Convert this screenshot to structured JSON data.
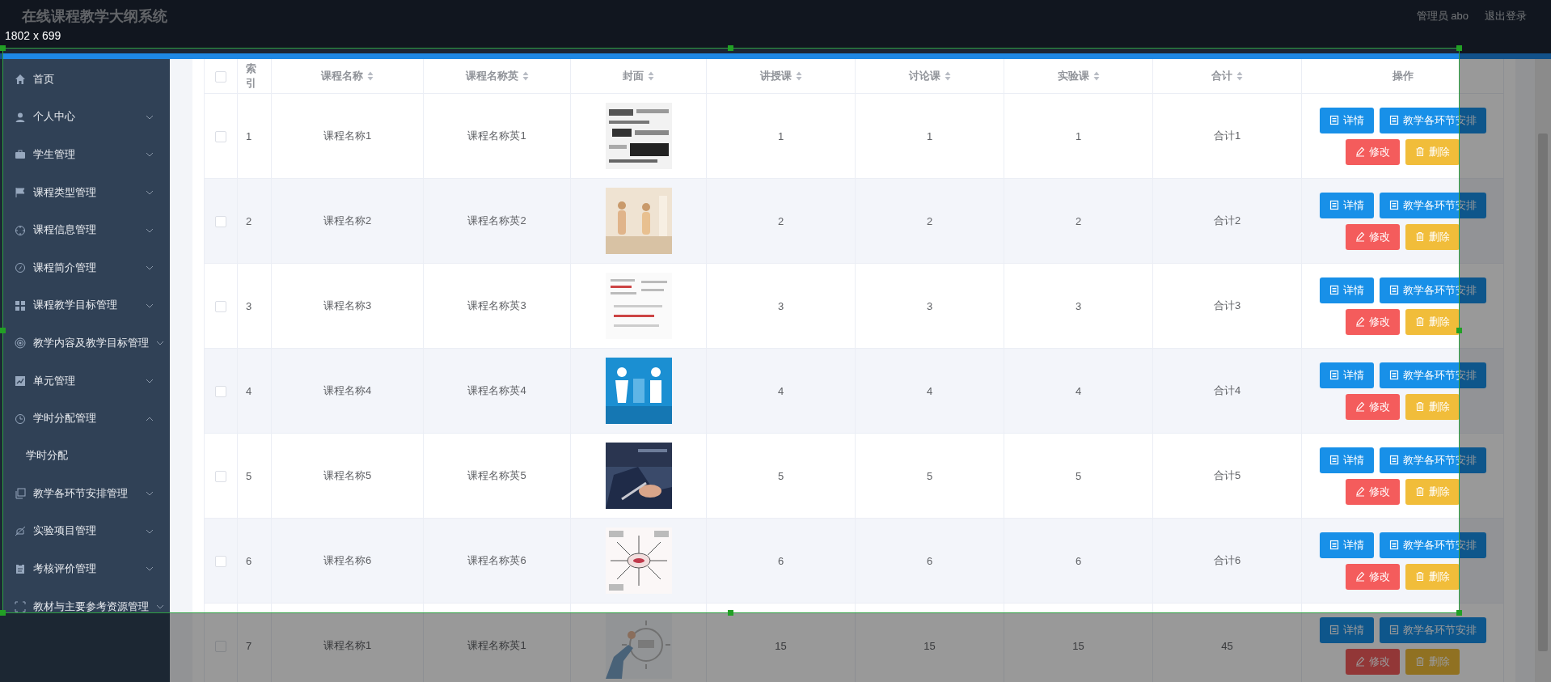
{
  "header": {
    "title": "在线课程教学大纲系统",
    "user": "管理员 abo",
    "logout": "退出登录"
  },
  "sidebar": {
    "items": [
      {
        "label": "首页"
      },
      {
        "label": "个人中心",
        "expanded": false
      },
      {
        "label": "学生管理",
        "expanded": false
      },
      {
        "label": "课程类型管理",
        "expanded": false
      },
      {
        "label": "课程信息管理",
        "expanded": false
      },
      {
        "label": "课程简介管理",
        "expanded": false
      },
      {
        "label": "课程教学目标管理",
        "expanded": false
      },
      {
        "label": "教学内容及教学目标管理",
        "expanded": false
      },
      {
        "label": "单元管理",
        "expanded": false
      },
      {
        "label": "学时分配管理",
        "expanded": true,
        "children": [
          {
            "label": "学时分配"
          }
        ]
      },
      {
        "label": "教学各环节安排管理",
        "expanded": false
      },
      {
        "label": "实验项目管理",
        "expanded": false
      },
      {
        "label": "考核评价管理",
        "expanded": false
      },
      {
        "label": "教材与主要参考资源管理",
        "expanded": false
      }
    ]
  },
  "table": {
    "select_all": {
      "checked": false
    },
    "columns": [
      {
        "label": "索引",
        "sortable": false
      },
      {
        "label": "课程名称",
        "sortable": true
      },
      {
        "label": "课程名称英",
        "sortable": true
      },
      {
        "label": "封面",
        "sortable": true
      },
      {
        "label": "讲授课",
        "sortable": true
      },
      {
        "label": "讨论课",
        "sortable": true
      },
      {
        "label": "实验课",
        "sortable": true
      },
      {
        "label": "合计",
        "sortable": true
      },
      {
        "label": "操作",
        "sortable": false
      }
    ],
    "rows": [
      {
        "checked": false,
        "cells": [
          "1",
          "课程名称1",
          "课程名称英1",
          {
            "kind": "picture"
          },
          "1",
          "1",
          "1",
          "合计1",
          {
            "actions": [
              {
                "label": "详情",
                "kind": "info"
              },
              {
                "label": "教学各环节安排",
                "kind": "info"
              },
              {
                "label": "修改",
                "kind": "edit"
              },
              {
                "label": "删除",
                "kind": "delete"
              }
            ]
          }
        ]
      },
      {
        "checked": false,
        "cells": [
          "2",
          "课程名称2",
          "课程名称英2",
          {
            "kind": "picture"
          },
          "2",
          "2",
          "2",
          "合计2",
          {
            "actions": [
              {
                "label": "详情",
                "kind": "info"
              },
              {
                "label": "教学各环节安排",
                "kind": "info"
              },
              {
                "label": "修改",
                "kind": "edit"
              },
              {
                "label": "删除",
                "kind": "delete"
              }
            ]
          }
        ]
      },
      {
        "checked": false,
        "cells": [
          "3",
          "课程名称3",
          "课程名称英3",
          {
            "kind": "picture"
          },
          "3",
          "3",
          "3",
          "合计3",
          {
            "actions": [
              {
                "label": "详情",
                "kind": "info"
              },
              {
                "label": "教学各环节安排",
                "kind": "info"
              },
              {
                "label": "修改",
                "kind": "edit"
              },
              {
                "label": "删除",
                "kind": "delete"
              }
            ]
          }
        ]
      },
      {
        "checked": false,
        "cells": [
          "4",
          "课程名称4",
          "课程名称英4",
          {
            "kind": "picture"
          },
          "4",
          "4",
          "4",
          "合计4",
          {
            "actions": [
              {
                "label": "详情",
                "kind": "info"
              },
              {
                "label": "教学各环节安排",
                "kind": "info"
              },
              {
                "label": "修改",
                "kind": "edit"
              },
              {
                "label": "删除",
                "kind": "delete"
              }
            ]
          }
        ]
      },
      {
        "checked": false,
        "cells": [
          "5",
          "课程名称5",
          "课程名称英5",
          {
            "kind": "picture"
          },
          "5",
          "5",
          "5",
          "合计5",
          {
            "actions": [
              {
                "label": "详情",
                "kind": "info"
              },
              {
                "label": "教学各环节安排",
                "kind": "info"
              },
              {
                "label": "修改",
                "kind": "edit"
              },
              {
                "label": "删除",
                "kind": "delete"
              }
            ]
          }
        ]
      },
      {
        "checked": false,
        "cells": [
          "6",
          "课程名称6",
          "课程名称英6",
          {
            "kind": "picture"
          },
          "6",
          "6",
          "6",
          "合计6",
          {
            "actions": [
              {
                "label": "详情",
                "kind": "info"
              },
              {
                "label": "教学各环节安排",
                "kind": "info"
              },
              {
                "label": "修改",
                "kind": "edit"
              },
              {
                "label": "删除",
                "kind": "delete"
              }
            ]
          }
        ]
      },
      {
        "checked": false,
        "cells": [
          "7",
          "课程名称1",
          "课程名称英1",
          {
            "kind": "picture"
          },
          "15",
          "15",
          "15",
          "45",
          {
            "actions": [
              {
                "label": "详情",
                "kind": "info"
              },
              {
                "label": "教学各环节安排",
                "kind": "info"
              },
              {
                "label": "修改",
                "kind": "edit"
              },
              {
                "label": "删除",
                "kind": "delete"
              }
            ]
          }
        ]
      }
    ]
  },
  "capture_overlay": {
    "size_label": "1802 x 699"
  }
}
